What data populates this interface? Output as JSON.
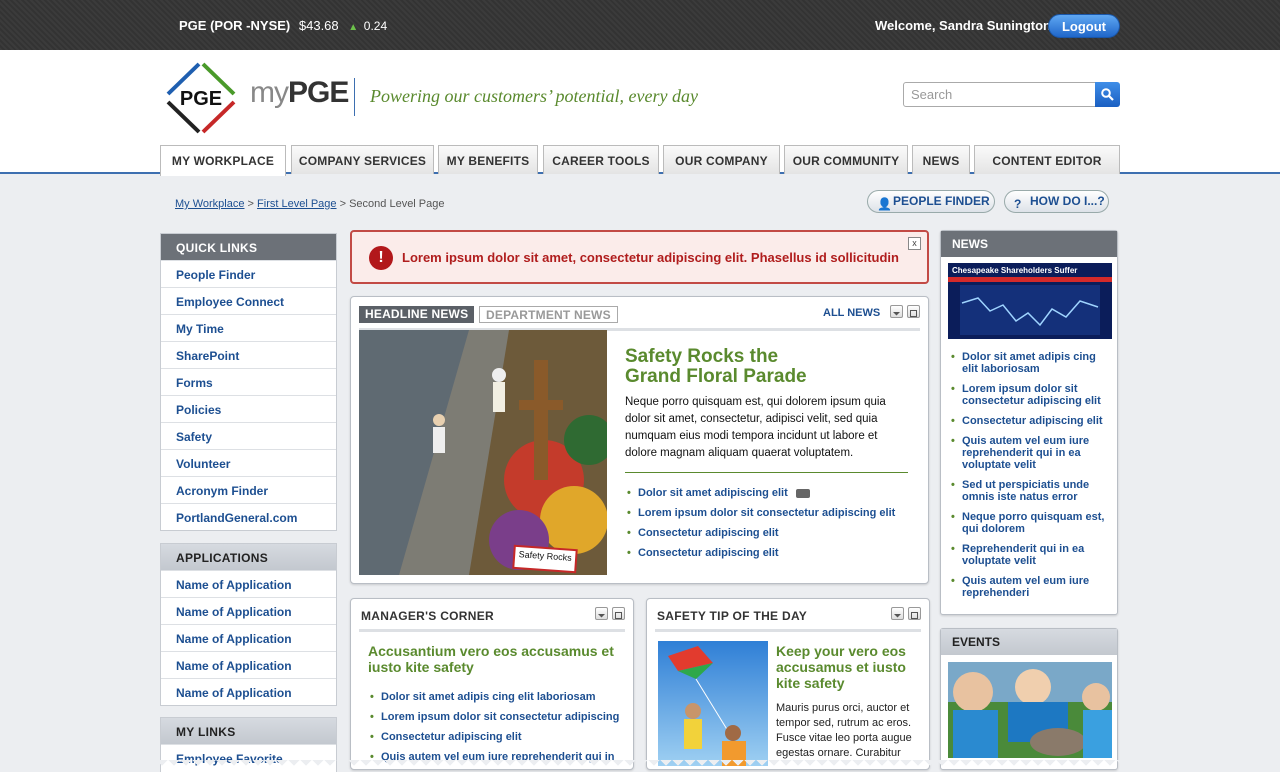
{
  "topbar": {
    "ticker_symbol": "PGE (POR -NYSE)",
    "price": "$43.68",
    "change": "0.24",
    "welcome": "Welcome, Sandra Sunington",
    "logout_label": "Logout"
  },
  "header": {
    "logo_text": "PGE",
    "brand_prefix": "my",
    "brand_suffix": "PGE",
    "tagline": "Powering our customers’ potential, every day",
    "search_placeholder": "Search"
  },
  "tabs": [
    "MY WORKPLACE",
    "COMPANY SERVICES",
    "MY BENEFITS",
    "CAREER TOOLS",
    "OUR COMPANY",
    "OUR COMMUNITY",
    "NEWS",
    "CONTENT EDITOR"
  ],
  "breadcrumb": {
    "item1": "My Workplace",
    "sep": ">",
    "item2": "First Level Page",
    "current": "Second Level Page"
  },
  "actions": {
    "people_finder": "PEOPLE FINDER",
    "how_do_i": "HOW DO I...?"
  },
  "quick_links": {
    "title": "QUICK LINKS",
    "items": [
      "People Finder",
      "Employee Connect",
      "My Time",
      "SharePoint",
      "Forms",
      "Policies",
      "Safety",
      "Volunteer",
      "Acronym Finder",
      "PortlandGeneral.com"
    ]
  },
  "applications": {
    "title": "APPLICATIONS",
    "items": [
      "Name of Application",
      "Name of Application",
      "Name of Application",
      "Name of Application",
      "Name of Application"
    ]
  },
  "my_links": {
    "title": "MY LINKS",
    "items": [
      "Employee Favorite"
    ]
  },
  "alert": {
    "message": "Lorem ipsum dolor sit amet, consectetur adipiscing elit. Phasellus id sollicitudin",
    "close": "x"
  },
  "headline": {
    "tab_active": "HEADLINE NEWS",
    "tab_inactive": "DEPARTMENT NEWS",
    "all_news": "ALL NEWS",
    "image_sign": "Safety Rocks",
    "title_line1": "Safety Rocks the",
    "title_line2": "Grand Floral Parade",
    "body": "Neque porro quisquam est, qui dolorem ipsum quia dolor sit amet, consectetur, adipisci velit, sed quia numquam eius modi tempora incidunt ut labore et dolore magnam aliquam quaerat voluptatem.",
    "links": [
      "Dolor sit amet adipiscing elit",
      "Lorem ipsum dolor sit consectetur adipiscing elit",
      "Consectetur adipiscing elit",
      "Consectetur adipiscing elit"
    ]
  },
  "managers_corner": {
    "title": "MANAGER'S CORNER",
    "heading": "Accusantium vero eos accusamus et iusto kite safety",
    "links": [
      "Dolor sit amet adipis cing elit laboriosam",
      "Lorem ipsum dolor sit consectetur adipiscing",
      "Consectetur adipiscing elit",
      "Quis autem vel eum iure reprehenderit qui in"
    ]
  },
  "safety_tip": {
    "title": "SAFETY TIP OF THE DAY",
    "heading": "Keep your vero eos accusamus et iusto kite safety",
    "body": "Mauris purus orci, auctor et tempor sed, rutrum ac eros. Fusce vitae leo porta augue egestas ornare. Curabitur"
  },
  "news": {
    "title": "NEWS",
    "image_caption": "Chesapeake Shareholders Suffer",
    "items": [
      "Dolor sit amet adipis cing elit laboriosam",
      "Lorem ipsum dolor sit consectetur adipiscing elit",
      "Consectetur adipiscing elit",
      "Quis autem vel eum iure reprehenderit qui in ea voluptate velit",
      "Sed ut perspiciatis unde omnis iste natus error",
      "Neque porro quisquam est, qui dolorem",
      "Reprehenderit qui in ea voluptate velit",
      "Quis autem vel eum iure reprehenderi"
    ]
  },
  "events": {
    "title": "EVENTS"
  },
  "colors": {
    "brand_blue": "#1d4f91",
    "green": "#5a8a2e",
    "alert_red": "#b01d1d",
    "header_gray": "#6c7178"
  }
}
